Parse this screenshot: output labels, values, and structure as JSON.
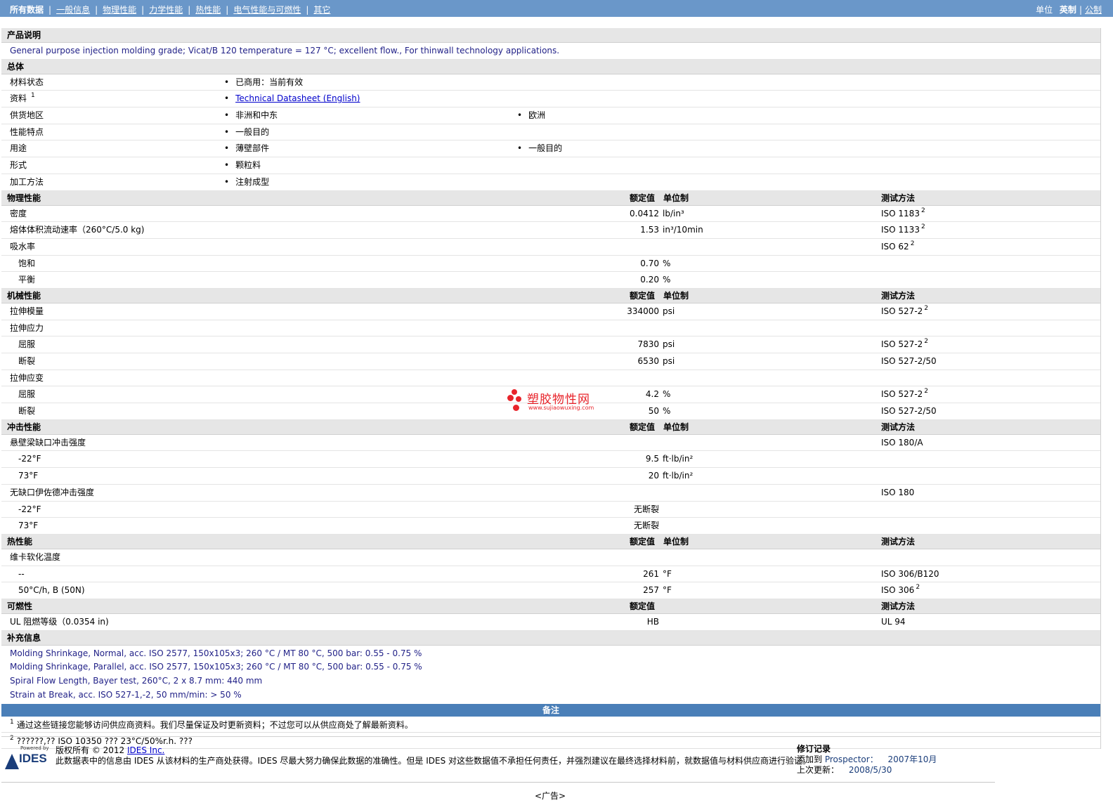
{
  "topnav": {
    "items": [
      "所有数据",
      "一般信息",
      "物理性能",
      "力学性能",
      "热性能",
      "电气性能与可燃性",
      "其它"
    ],
    "units_label": "单位",
    "unit_options": [
      "英制",
      "公制"
    ]
  },
  "product_desc": {
    "title": "产品说明",
    "text": "General purpose injection molding grade; Vicat/B 120 temperature = 127 °C; excellent flow., For thinwall technology applications."
  },
  "general": {
    "title": "总体",
    "rows": [
      {
        "label": "材料状态",
        "b1": "已商用：当前有效",
        "b2": ""
      },
      {
        "label": "资料",
        "sup": "1",
        "link": "Technical Datasheet (English)"
      },
      {
        "label": "供货地区",
        "b1": "非洲和中东",
        "b2": "欧洲"
      },
      {
        "label": "性能特点",
        "b1": "一般目的",
        "b2": ""
      },
      {
        "label": "用途",
        "b1": "薄壁部件",
        "b2": "一般目的"
      },
      {
        "label": "形式",
        "b1": "颗粒料",
        "b2": ""
      },
      {
        "label": "加工方法",
        "b1": "注射成型",
        "b2": ""
      }
    ]
  },
  "col_headers": {
    "value": "额定值",
    "unit": "单位制",
    "test": "测试方法"
  },
  "physical": {
    "title": "物理性能",
    "rows": [
      {
        "label": "密度",
        "value": "0.0412",
        "unit": "lb/in³",
        "test": "ISO 1183",
        "sup": "2"
      },
      {
        "label": "熔体体积流动速率（260°C/5.0 kg)",
        "value": "1.53",
        "unit": "in³/10min",
        "test": "ISO 1133",
        "sup": "2"
      },
      {
        "label": "吸水率",
        "value": "",
        "unit": "",
        "test": "ISO 62",
        "sup": "2"
      },
      {
        "label": "饱和",
        "value": "0.70",
        "unit": "%",
        "test": "",
        "sup": "",
        "indent": true
      },
      {
        "label": "平衡",
        "value": "0.20",
        "unit": "%",
        "test": "",
        "sup": "",
        "indent": true
      }
    ]
  },
  "mechanical": {
    "title": "机械性能",
    "rows": [
      {
        "label": "拉伸模量",
        "value": "334000",
        "unit": "psi",
        "test": "ISO 527-2",
        "sup": "2"
      },
      {
        "label": "拉伸应力",
        "value": "",
        "unit": "",
        "test": "",
        "sup": ""
      },
      {
        "label": "屈服",
        "value": "7830",
        "unit": "psi",
        "test": "ISO 527-2",
        "sup": "2",
        "indent": true
      },
      {
        "label": "断裂",
        "value": "6530",
        "unit": "psi",
        "test": "ISO 527-2/50",
        "sup": "",
        "indent": true
      },
      {
        "label": "拉伸应变",
        "value": "",
        "unit": "",
        "test": "",
        "sup": ""
      },
      {
        "label": "屈服",
        "value": "4.2",
        "unit": "%",
        "test": "ISO 527-2",
        "sup": "2",
        "indent": true
      },
      {
        "label": "断裂",
        "value": "50",
        "unit": "%",
        "test": "ISO 527-2/50",
        "sup": "",
        "indent": true
      }
    ]
  },
  "impact": {
    "title": "冲击性能",
    "rows": [
      {
        "label": "悬壁梁缺口冲击强度",
        "value": "",
        "unit": "",
        "test": "ISO 180/A",
        "sup": ""
      },
      {
        "label": "-22°F",
        "value": "9.5",
        "unit": "ft·lb/in²",
        "test": "",
        "sup": "",
        "indent": true
      },
      {
        "label": "73°F",
        "value": "20",
        "unit": "ft·lb/in²",
        "test": "",
        "sup": "",
        "indent": true
      },
      {
        "label": "无缺口伊佐德冲击强度",
        "value": "",
        "unit": "",
        "test": "ISO 180",
        "sup": ""
      },
      {
        "label": "-22°F",
        "value": "无断裂",
        "unit": "",
        "test": "",
        "sup": "",
        "indent": true
      },
      {
        "label": "73°F",
        "value": "无断裂",
        "unit": "",
        "test": "",
        "sup": "",
        "indent": true
      }
    ]
  },
  "thermal": {
    "title": "热性能",
    "rows": [
      {
        "label": "维卡软化温度",
        "value": "",
        "unit": "",
        "test": "",
        "sup": ""
      },
      {
        "label": "--",
        "value": "261",
        "unit": "°F",
        "test": "ISO 306/B120",
        "sup": "",
        "indent": true
      },
      {
        "label": "50°C/h, B (50N)",
        "value": "257",
        "unit": "°F",
        "test": "ISO 306",
        "sup": "2",
        "indent": true
      }
    ]
  },
  "flammability": {
    "title": "可燃性",
    "rows": [
      {
        "label": "UL 阻燃等级（0.0354 in)",
        "value": "HB",
        "unit": "",
        "test": "UL 94",
        "sup": ""
      }
    ]
  },
  "supplement": {
    "title": "补充信息",
    "lines": [
      "Molding Shrinkage, Normal, acc. ISO 2577, 150x105x3; 260 °C / MT 80 °C, 500 bar: 0.55 - 0.75 %",
      "Molding Shrinkage, Parallel, acc. ISO 2577, 150x105x3; 260 °C / MT 80 °C, 500 bar: 0.55 - 0.75 %",
      "Spiral Flow Length, Bayer test, 260°C, 2 x 8.7 mm: 440 mm",
      "Strain at Break, acc. ISO 527-1,-2, 50 mm/min: > 50 %"
    ]
  },
  "notes": {
    "title": "备注",
    "items": [
      {
        "num": "1",
        "text": "通过这些链接您能够访问供应商资料。我们尽量保证及时更新资料；不过您可以从供应商处了解最新资料。"
      },
      {
        "num": "2",
        "text": "??????,?? ISO 10350 ??? 23°C/50%r.h. ???"
      }
    ]
  },
  "footer": {
    "powered_by": "Powered by",
    "logo_text": "IDES",
    "copyright": "版权所有 © 2012",
    "company_link": "IDES Inc.",
    "disclaimer": "此数据表中的信息由 IDES 从该材料的生产商处获得。IDES 尽最大努力确保此数据的准确性。但是 IDES 对这些数据值不承担任何责任，并强烈建议在最终选择材料前，就数据值与材料供应商进行验证。",
    "revision_title": "修订记录",
    "added_label": "添加到",
    "added_source": "Prospector：",
    "added_date": "2007年10月",
    "updated_label": "上次更新：",
    "updated_date": "2008/5/30"
  },
  "watermark": {
    "name": "塑胶物性网",
    "url": "www.sujiaowuxing.com"
  },
  "ad": "<广告>",
  "colors": {
    "topbar": "#6a97c9",
    "notes_bar": "#4a7fb8",
    "section_bg": "#e6e6e6",
    "text_blue": "#222288"
  }
}
